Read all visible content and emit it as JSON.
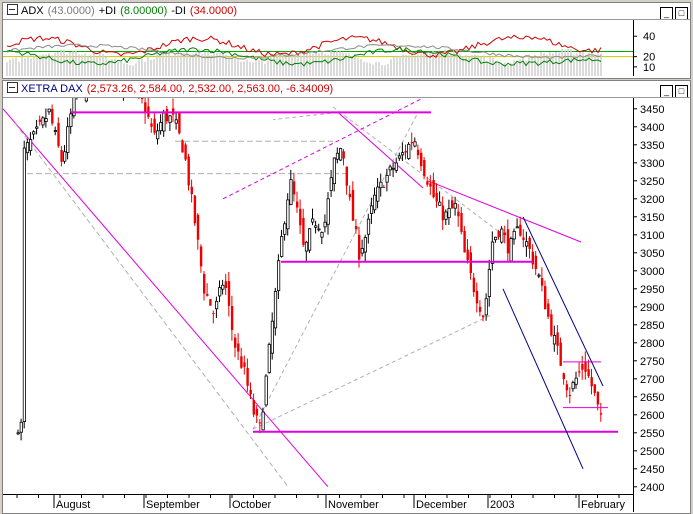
{
  "adx_panel": {
    "label": "ADX",
    "adx_value": "(43.0000)",
    "plus_di_label": "+DI",
    "plus_di_value": "(8.00000)",
    "minus_di_label": "-DI",
    "minus_di_value": "(34.0000)",
    "colors": {
      "adx": "#8a8a8a",
      "plus_di": "#008000",
      "minus_di": "#d00000",
      "level_hi": "#00aa00",
      "level_lo": "#c8c800"
    },
    "levels": [
      25,
      20
    ],
    "axis_ticks": [
      "40",
      "20",
      "10"
    ]
  },
  "price_panel": {
    "label": "XETRA DAX",
    "values_text": "(2,573.26, 2,584.00, 2,532.00, 2,563.00, -6.34009)",
    "colors": {
      "up": "#000000",
      "down": "#ee0000",
      "trendline": "#e000e0",
      "channel": "#00008b",
      "ray": "#b0b0b0"
    },
    "y_ticks": [
      "3450",
      "3400",
      "3350",
      "3300",
      "3250",
      "3200",
      "3150",
      "3100",
      "3050",
      "3000",
      "2950",
      "2900",
      "2850",
      "2800",
      "2750",
      "2700",
      "2650",
      "2600",
      "2550",
      "2500",
      "2450",
      "2400"
    ],
    "x_labels": [
      "August",
      "September",
      "October",
      "November",
      "December",
      "2003",
      "February"
    ]
  },
  "window_buttons": {
    "minimize": "_",
    "maximize": "□"
  },
  "chart_data": {
    "type": "candlestick",
    "title": "XETRA DAX",
    "ylim": [
      2380,
      3480
    ],
    "x_labels": [
      "August",
      "September",
      "October",
      "November",
      "December",
      "2003",
      "February"
    ],
    "ohlc_sample": [
      {
        "period": "late Sep 2002",
        "low": 2750
      },
      {
        "period": "Oct 2002 low",
        "low": 2519
      },
      {
        "period": "Nov 2002 high",
        "high": 3470
      },
      {
        "period": "late Jan 2003",
        "low": 2450
      },
      {
        "period": "last",
        "open": 2573.26,
        "high": 2584.0,
        "low": 2532.0,
        "close": 2563.0,
        "change": -6.34009
      }
    ],
    "horizontal_levels": [
      3440,
      3025,
      2553,
      2747,
      2620
    ],
    "adx_last": {
      "adx": 43.0,
      "plus_di": 8.0,
      "minus_di": 34.0
    }
  }
}
